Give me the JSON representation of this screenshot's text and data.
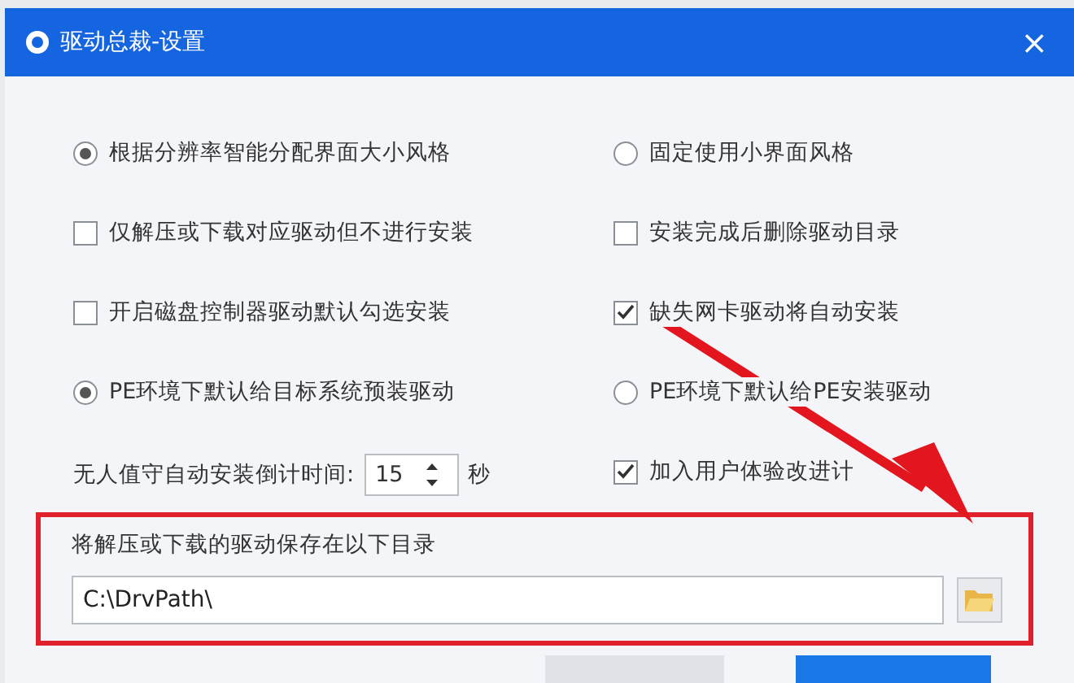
{
  "window": {
    "title": "驱动总裁-设置",
    "close": "×"
  },
  "options": [
    {
      "kind": "radio",
      "label": "根据分辨率智能分配界面大小风格",
      "selected": true
    },
    {
      "kind": "radio",
      "label": "固定使用小界面风格",
      "selected": false
    },
    {
      "kind": "checkbox",
      "label": "仅解压或下载对应驱动但不进行安装",
      "checked": false
    },
    {
      "kind": "checkbox",
      "label": "安装完成后删除驱动目录",
      "checked": false
    },
    {
      "kind": "checkbox",
      "label": "开启磁盘控制器驱动默认勾选安装",
      "checked": false
    },
    {
      "kind": "checkbox",
      "label": "缺失网卡驱动将自动安装",
      "checked": true
    },
    {
      "kind": "radio",
      "label": "PE环境下默认给目标系统预装驱动",
      "selected": true
    },
    {
      "kind": "radio",
      "label": "PE环境下默认给PE安装驱动",
      "selected": false
    }
  ],
  "countdown": {
    "label": "无人值守自动安装倒计时间:",
    "value": "15",
    "unit": "秒"
  },
  "experience": {
    "kind": "checkbox",
    "label": "加入用户体验改进计",
    "checked": true
  },
  "directory": {
    "label": "将解压或下载的驱动保存在以下目录",
    "value": "C:\\DrvPath\\"
  },
  "buttons": [
    {
      "kind": "secondary"
    },
    {
      "kind": "primary"
    }
  ]
}
